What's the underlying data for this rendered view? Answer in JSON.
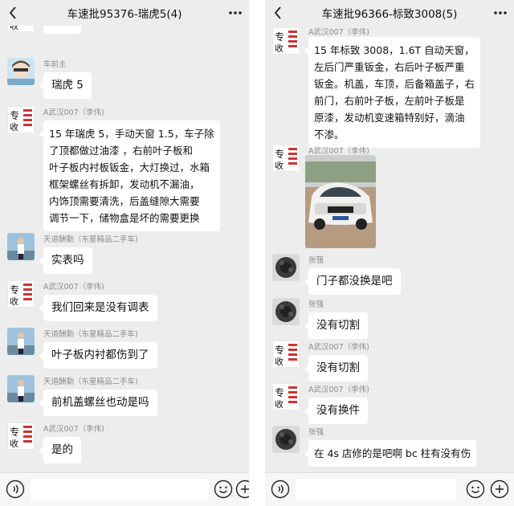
{
  "left_chat": {
    "title": "车速批95376-瑞虎5(4)",
    "icons": {
      "back": "back-icon",
      "more": "more-icon",
      "voice": "voice-icon",
      "emoji": "emoji-icon",
      "plus": "plus-icon"
    },
    "messages": [
      {
        "sender": "",
        "avatar": "zhuanshou-logo",
        "lines": [
          "李伟"
        ]
      },
      {
        "sender": "车前主",
        "avatar": "anime-avatar",
        "lines": [
          "瑞虎 5"
        ]
      },
      {
        "sender": "A武汉007（李伟)",
        "avatar": "zhuanshou-logo",
        "lines": [
          "15 年瑞虎 5，手动天窗 1.5，车子除",
          "了顶都做过油漆 ，右前叶子板和",
          "叶子板内衬板钣金，大灯换过，水箱",
          "框架螺丝有拆卸，发动机不漏油，",
          "内饰顶需要清洗，后盖缝隙大需要",
          "调节一下，储物盒是坏的需要更换"
        ]
      },
      {
        "sender": "天道酬勤（东星精品二手车)",
        "avatar": "person-avatar",
        "lines": [
          "实表吗"
        ]
      },
      {
        "sender": "A武汉007（李伟)",
        "avatar": "zhuanshou-logo",
        "lines": [
          "我们回来是没有调表"
        ]
      },
      {
        "sender": "天道酬勤（东星精品二手车)",
        "avatar": "person-avatar",
        "lines": [
          "叶子板内衬都伤到了"
        ]
      },
      {
        "sender": "天道酬勤（东星精品二手车)",
        "avatar": "person-avatar",
        "lines": [
          "前机盖螺丝也动是吗"
        ]
      },
      {
        "sender": "A武汉007（李伟)",
        "avatar": "zhuanshou-logo",
        "lines": [
          "是的"
        ]
      }
    ]
  },
  "right_chat": {
    "title": "车速批96366-标致3008(5)",
    "icons": {
      "back": "back-icon",
      "more": "more-icon",
      "voice": "voice-icon",
      "emoji": "emoji-icon",
      "plus": "plus-icon"
    },
    "messages": [
      {
        "sender": "A武汉007（李伟)",
        "avatar": "zhuanshou-logo",
        "lines": [
          "15 年标致 3008，1.6T 自动天窗，",
          "左后门严重钣金，右后叶子板严重",
          "钣金。机盖，车顶，后备箱盖子，右",
          "前门，右前叶子板，左前叶子板是",
          "原漆，发动机变速箱特别好，滴油",
          "不渗。"
        ]
      },
      {
        "sender": "A武汉007（李伟)",
        "avatar": "zhuanshou-logo",
        "image": "white-suv-photo"
      },
      {
        "sender": "张强",
        "avatar": "dark-avatar",
        "lines": [
          "门子都没换是吧"
        ]
      },
      {
        "sender": "张强",
        "avatar": "dark-avatar",
        "lines": [
          "没有切割"
        ]
      },
      {
        "sender": "A武汉007（李伟)",
        "avatar": "zhuanshou-logo",
        "lines": [
          "没有切割"
        ]
      },
      {
        "sender": "A武汉007（李伟)",
        "avatar": "zhuanshou-logo",
        "lines": [
          "没有换件"
        ]
      },
      {
        "sender": "张强",
        "avatar": "dark-avatar",
        "lines": [
          "在 4s 店修的是吧啊 bc 柱有没有伤"
        ]
      }
    ]
  },
  "colors": {
    "background": "#ededed",
    "bubble": "#ffffff",
    "sender_text": "#8c8c8c",
    "divider": "#ffffff"
  }
}
